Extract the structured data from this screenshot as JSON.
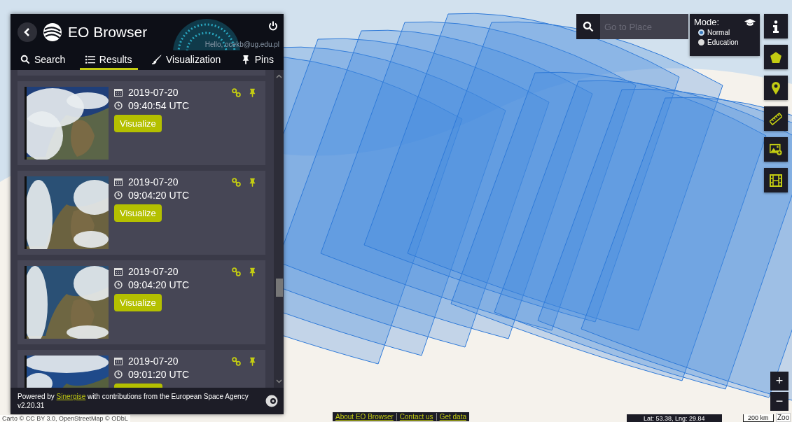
{
  "panel": {
    "title": "EO Browser",
    "greeting": "Hello, ocekb@ug.edu.pl",
    "tabs": [
      {
        "kind": "search",
        "label": "Search",
        "selected": false
      },
      {
        "kind": "list",
        "label": "Results",
        "selected": true
      },
      {
        "kind": "brush",
        "label": "Visualization",
        "selected": false
      },
      {
        "kind": "pin",
        "label": "Pins",
        "selected": false
      }
    ],
    "results": [
      {
        "date": "2019-07-20",
        "time": "09:40:54 UTC",
        "button": "Visualize"
      },
      {
        "date": "2019-07-20",
        "time": "09:04:20 UTC",
        "button": "Visualize"
      },
      {
        "date": "2019-07-20",
        "time": "09:04:20 UTC",
        "button": "Visualize"
      },
      {
        "date": "2019-07-20",
        "time": "09:01:20 UTC"
      }
    ],
    "footer": {
      "text_before": "Powered by",
      "link": "Sinergise",
      "text_after": "with contributions from the European Space Agency",
      "version": "v2.20.31"
    }
  },
  "place_search": {
    "placeholder": "Go to Place"
  },
  "mode": {
    "label": "Mode:",
    "options": [
      {
        "label": "Normal",
        "selected": true
      },
      {
        "label": "Education",
        "selected": false
      }
    ]
  },
  "tools": [
    {
      "kind": "info"
    },
    {
      "kind": "polygon"
    },
    {
      "kind": "marker"
    },
    {
      "kind": "ruler"
    },
    {
      "kind": "image-download"
    },
    {
      "kind": "film"
    }
  ],
  "zoom": [
    "+",
    "−"
  ],
  "tooltip": "Zoo",
  "map_links": [
    "About EO Browser",
    "Contact us",
    "Get data"
  ],
  "coordinates": "Lat: 53.38, Lng: 29.84",
  "scale": "200 km",
  "attribution": "Carto © CC BY 3.0, OpenStreetMap © ODbL"
}
